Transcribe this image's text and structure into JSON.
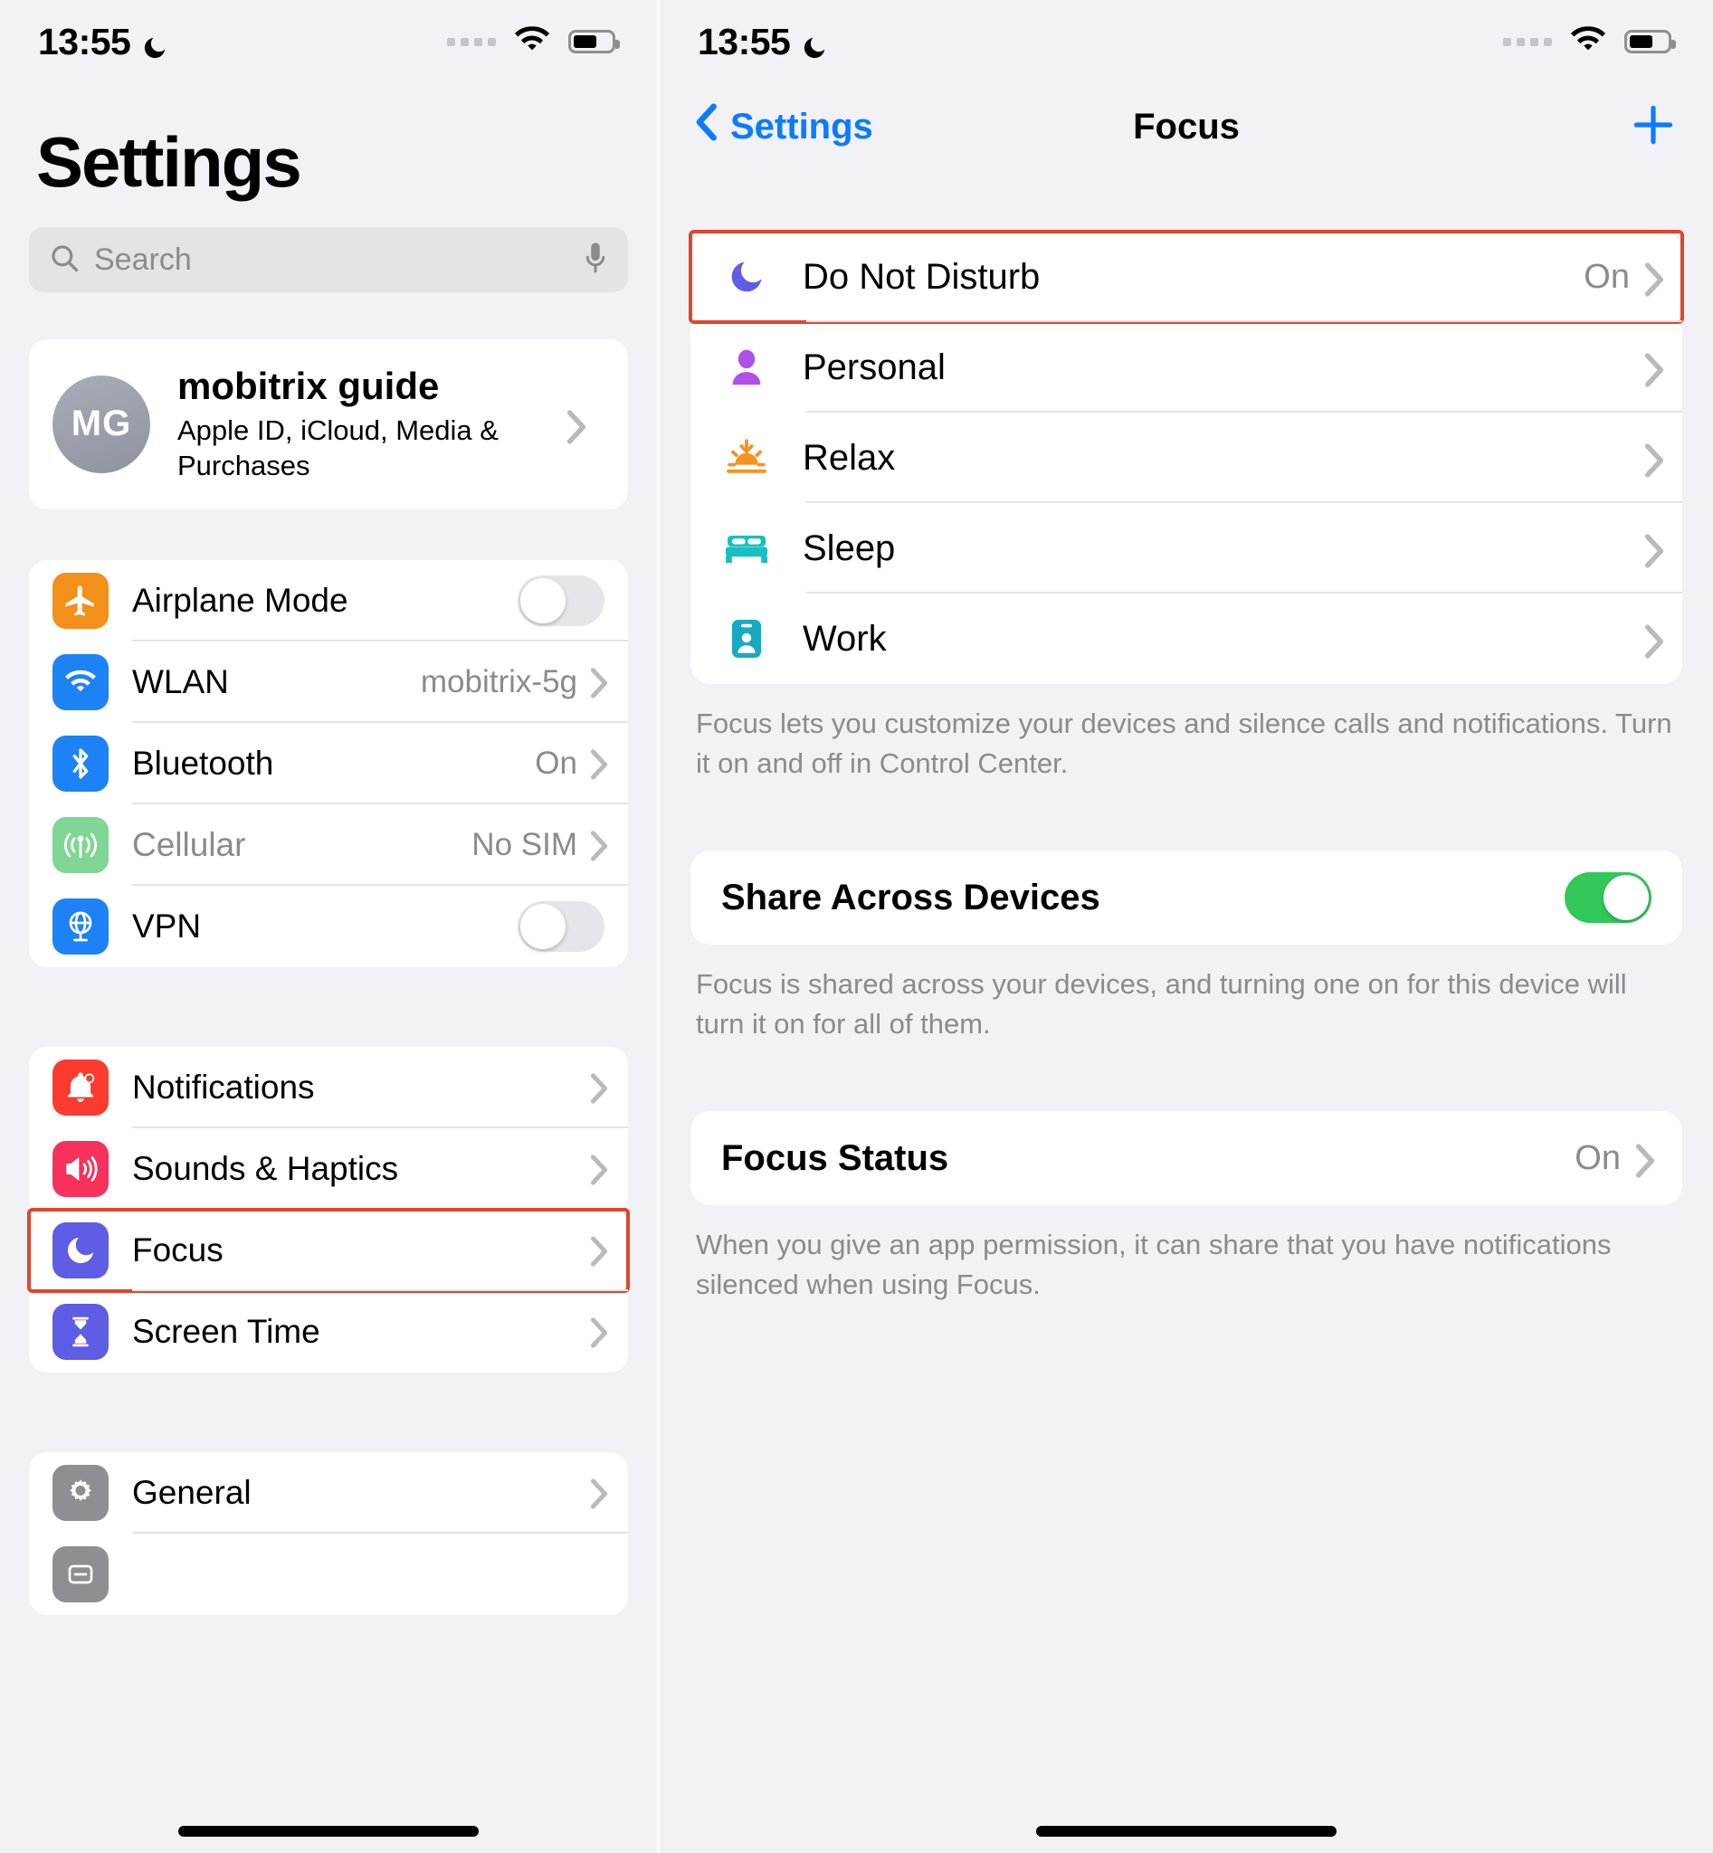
{
  "status_bar": {
    "time": "13:55",
    "moon_icon": "crescent-moon-icon",
    "signal_icon": "signal-dots-icon",
    "wifi_icon": "wifi-icon",
    "battery_icon": "battery-icon"
  },
  "left_screen": {
    "title": "Settings",
    "search": {
      "placeholder": "Search",
      "icon": "search-icon",
      "mic_icon": "microphone-icon"
    },
    "account": {
      "initials": "MG",
      "name": "mobitrix guide",
      "subtitle": "Apple ID, iCloud, Media & Purchases"
    },
    "group_connectivity": [
      {
        "label": "Airplane Mode",
        "icon": "airplane-icon",
        "icon_color": "#f39019",
        "control": "toggle",
        "toggle_on": false
      },
      {
        "label": "WLAN",
        "icon": "wifi-icon",
        "icon_color": "#1d82f5",
        "control": "value",
        "value": "mobitrix-5g"
      },
      {
        "label": "Bluetooth",
        "icon": "bluetooth-icon",
        "icon_color": "#1d82f5",
        "control": "value",
        "value": "On"
      },
      {
        "label": "Cellular",
        "icon": "cellular-icon",
        "icon_color": "#80d695",
        "control": "value",
        "value": "No SIM",
        "dim": true
      },
      {
        "label": "VPN",
        "icon": "vpn-globe-icon",
        "icon_color": "#1d82f5",
        "control": "toggle",
        "toggle_on": false
      }
    ],
    "group_system": [
      {
        "label": "Notifications",
        "icon": "bell-icon",
        "icon_color": "#fa3b30",
        "control": "chevron",
        "highlighted": false
      },
      {
        "label": "Sounds & Haptics",
        "icon": "speaker-icon",
        "icon_color": "#f6315c",
        "control": "chevron",
        "highlighted": false
      },
      {
        "label": "Focus",
        "icon": "moon-icon",
        "icon_color": "#5f5ce6",
        "control": "chevron",
        "highlighted": true
      },
      {
        "label": "Screen Time",
        "icon": "hourglass-icon",
        "icon_color": "#5f5ce6",
        "control": "chevron",
        "highlighted": false
      }
    ],
    "group_general": [
      {
        "label": "General",
        "icon": "gear-icon",
        "icon_color": "#8e8e93",
        "control": "chevron"
      }
    ]
  },
  "right_screen": {
    "nav": {
      "back_label": "Settings",
      "title": "Focus",
      "add_icon": "plus-icon",
      "back_icon": "chevron-left-icon"
    },
    "focus_modes": [
      {
        "label": "Do Not Disturb",
        "icon": "crescent-moon-icon",
        "icon_color": "#5f5ce6",
        "value": "On",
        "highlighted": true
      },
      {
        "label": "Personal",
        "icon": "person-icon",
        "icon_color": "#b050e8",
        "value": "",
        "highlighted": false
      },
      {
        "label": "Relax",
        "icon": "sunrise-icon",
        "icon_color": "#f7921e",
        "value": "",
        "highlighted": false
      },
      {
        "label": "Sleep",
        "icon": "bed-icon",
        "icon_color": "#17bfbf",
        "value": "",
        "highlighted": false
      },
      {
        "label": "Work",
        "icon": "badge-id-icon",
        "icon_color": "#19a9c4",
        "value": "",
        "highlighted": false
      }
    ],
    "focus_footnote": "Focus lets you customize your devices and silence calls and notifications. Turn it on and off in Control Center.",
    "share_across_devices": {
      "label": "Share Across Devices",
      "toggle_on": true
    },
    "share_footnote": "Focus is shared across your devices, and turning one on for this device will turn it on for all of them.",
    "focus_status": {
      "label": "Focus Status",
      "value": "On"
    },
    "status_footnote": "When you give an app permission, it can share that you have notifications silenced when using Focus."
  },
  "colors": {
    "accent_blue": "#0a7cff",
    "highlight_red": "#e0452c",
    "toggle_green": "#32c759",
    "background": "#f1f1f6"
  }
}
